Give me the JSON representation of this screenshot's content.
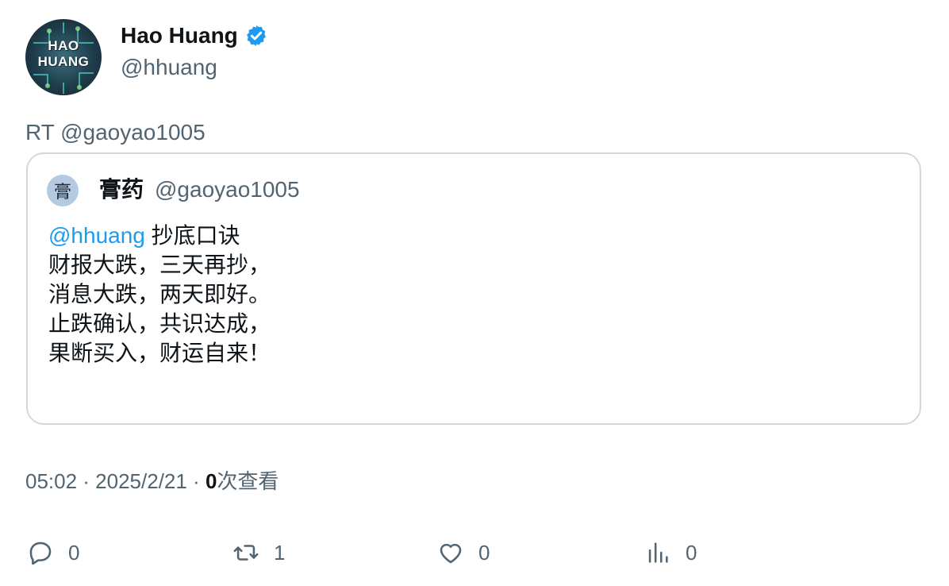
{
  "author": {
    "display_name": "Hao Huang",
    "handle": "@hhuang",
    "avatar_text_line1": "HAO",
    "avatar_text_line2": "HUANG"
  },
  "retweet_prefix": "RT @gaoyao1005",
  "quote": {
    "avatar_glyph": "膏",
    "name": "膏药",
    "handle": "@gaoyao1005",
    "mention": "@hhuang",
    "line1_rest": " 抄底口诀",
    "line2": "财报大跌，三天再抄，",
    "line3": "消息大跌，两天即好。",
    "line4": "止跌确认，共识达成，",
    "line5": "果断买入，财运自来！"
  },
  "meta": {
    "time_date": "05:02 · 2025/2/21 · ",
    "views_count": "0",
    "views_label": "次查看"
  },
  "actions": {
    "reply_count": "0",
    "retweet_count": "1",
    "like_count": "0",
    "views_count": "0"
  },
  "colors": {
    "accent": "#1d9bf0",
    "secondary_text": "#536471",
    "border": "#cfd9de"
  }
}
